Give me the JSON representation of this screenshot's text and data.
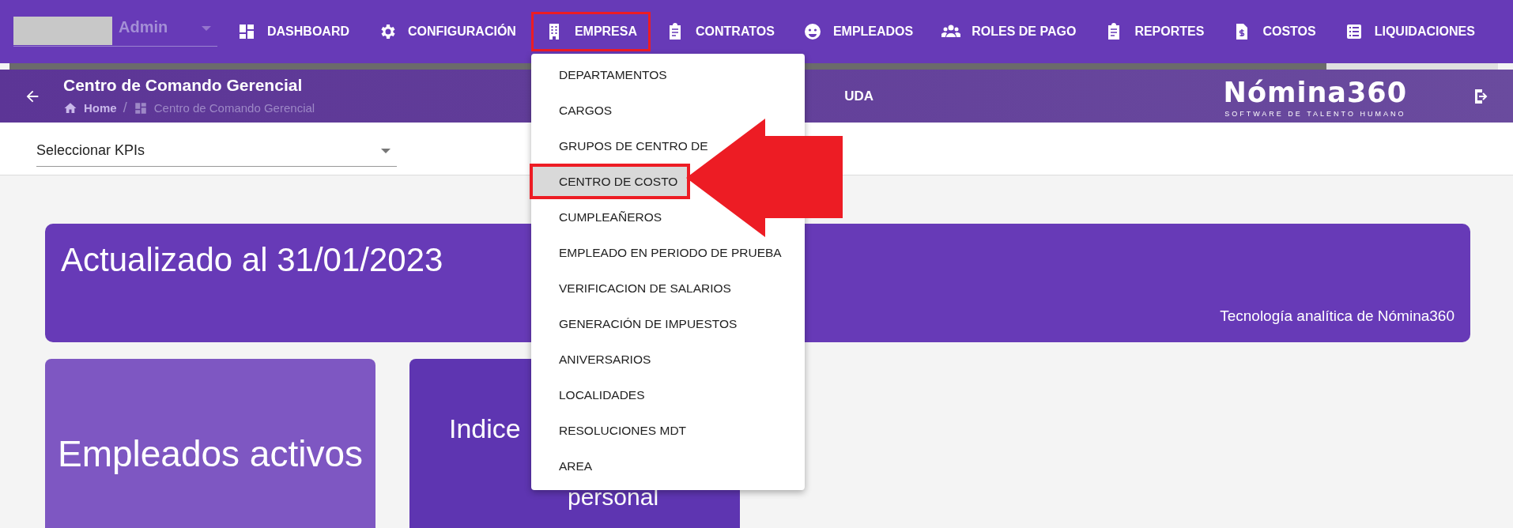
{
  "user_select": {
    "value": "Admin"
  },
  "nav": [
    {
      "label": "DASHBOARD",
      "highlighted": false
    },
    {
      "label": "CONFIGURACIÓN",
      "highlighted": false
    },
    {
      "label": "EMPRESA",
      "highlighted": true
    },
    {
      "label": "CONTRATOS",
      "highlighted": false
    },
    {
      "label": "EMPLEADOS",
      "highlighted": false
    },
    {
      "label": "ROLES DE PAGO",
      "highlighted": false
    },
    {
      "label": "REPORTES",
      "highlighted": false
    },
    {
      "label": "COSTOS",
      "highlighted": false
    },
    {
      "label": "LIQUIDACIONES",
      "highlighted": false
    }
  ],
  "progress": {
    "level": 0.885
  },
  "header": {
    "title": "Centro de Comando Gerencial",
    "breadcrumb": [
      "Home",
      "Centro de Comando Gerencial"
    ],
    "breadcrumb_separator": "/",
    "help_link": "UDA",
    "logo": "Nómina360",
    "logo_tagline": "SOFTWARE DE TALENTO HUMANO"
  },
  "kpi_select": {
    "placeholder": "Seleccionar KPIs"
  },
  "banner": {
    "title": "Actualizado al 31/01/2023",
    "footer": "Tecnología analítica de Nómina360"
  },
  "cards": [
    {
      "lines": [
        "Empleados activos"
      ]
    },
    {
      "lines": [
        "Indice",
        "personal"
      ]
    }
  ],
  "menu": [
    {
      "label": "DEPARTAMENTOS",
      "selected": false,
      "highlighted": false
    },
    {
      "label": "CARGOS",
      "selected": false,
      "highlighted": false
    },
    {
      "label": "GRUPOS DE CENTRO DE",
      "selected": false,
      "highlighted": false
    },
    {
      "label": "CENTRO DE COSTO",
      "selected": true,
      "highlighted": true
    },
    {
      "label": "CUMPLEAÑEROS",
      "selected": false,
      "highlighted": false
    },
    {
      "label": "EMPLEADO EN PERIODO DE PRUEBA",
      "selected": false,
      "highlighted": false
    },
    {
      "label": "VERIFICACION DE SALARIOS",
      "selected": false,
      "highlighted": false
    },
    {
      "label": "GENERACIÓN DE IMPUESTOS",
      "selected": false,
      "highlighted": false
    },
    {
      "label": "ANIVERSARIOS",
      "selected": false,
      "highlighted": false
    },
    {
      "label": "LOCALIDADES",
      "selected": false,
      "highlighted": false
    },
    {
      "label": "RESOLUCIONES MDT",
      "selected": false,
      "highlighted": false
    },
    {
      "label": "AREA",
      "selected": false,
      "highlighted": false
    }
  ]
}
